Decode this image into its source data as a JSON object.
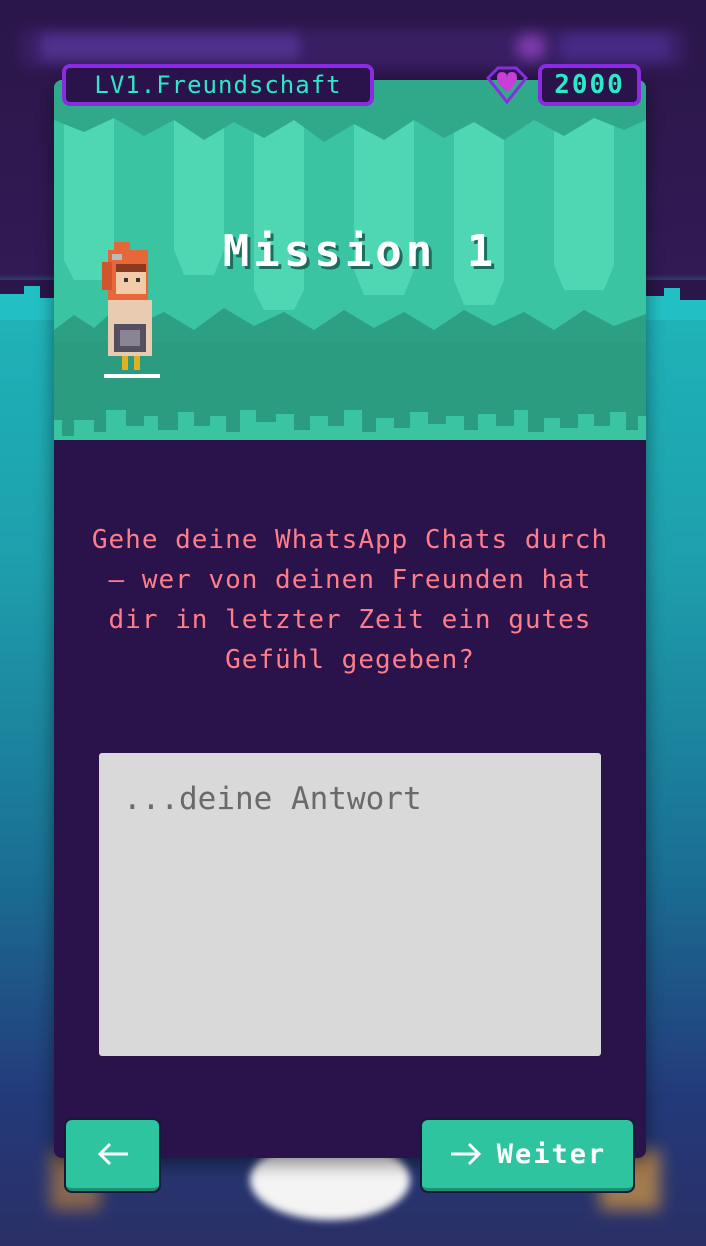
{
  "header": {
    "level_label": "LV1.Freundschaft",
    "score": "2000"
  },
  "mission": {
    "title": "Mission 1",
    "question": "Gehe deine WhatsApp Chats durch – wer von deinen Freunden hat dir in letzter Zeit ein gutes Gefühl gegeben?",
    "answer_placeholder": "...deine Antwort",
    "answer_value": ""
  },
  "navigation": {
    "back_icon": "arrow-left-icon",
    "next_icon": "arrow-right-icon",
    "next_label": "Weiter"
  },
  "icons": {
    "score": "heart-gem-icon",
    "character": "hooded-girl-sprite"
  },
  "colors": {
    "card_bg": "#2a124a",
    "accent_purple": "#8a2be2",
    "accent_teal": "#2ee8c8",
    "question_text": "#ff7d8a",
    "button_green": "#2ec4a0",
    "forest_green": "#3cc4a0"
  }
}
